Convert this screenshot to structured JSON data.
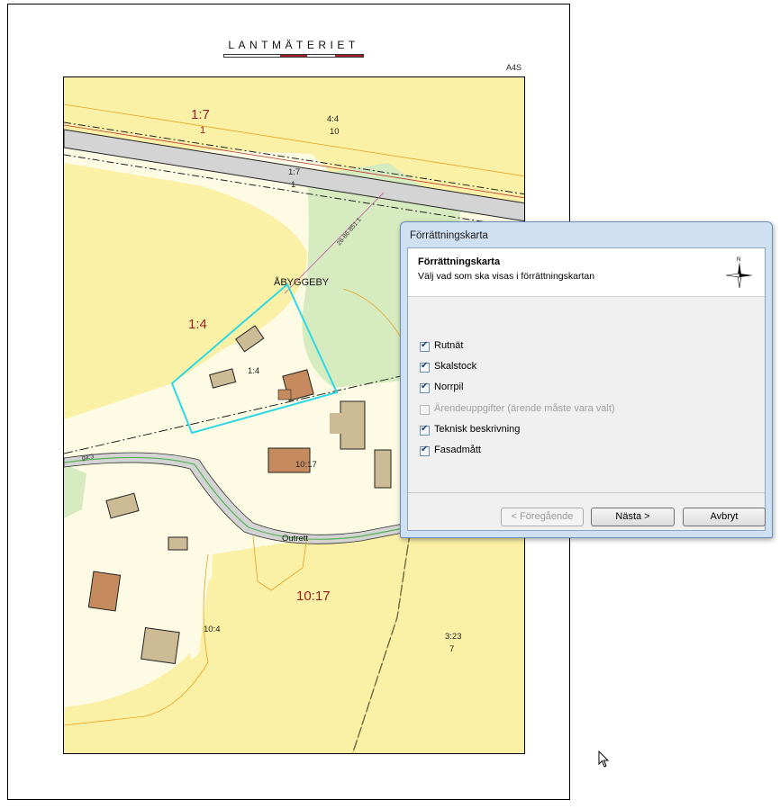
{
  "sheet": {
    "logo_text": "LANTMÄTERIET",
    "format_label": "A4S"
  },
  "map": {
    "labels": {
      "parcel_1_7_big": "1:7",
      "parcel_1_7_big_sub": "1",
      "parcel_4_4": "4:4",
      "parcel_4_4_sub": "10",
      "parcel_1_7_road": "1:7",
      "parcel_1_7_road_sub": "1",
      "boundary_line": "28-86-851.1",
      "village_name": "ÅBYGGEBY",
      "parcel_1_4_big": "1:4",
      "parcel_1_4_small": "1:4",
      "parcel_10_17_small": "10:17",
      "ga_label": "ga:3",
      "road_name": "Outrett",
      "parcel_10_17_big": "10:17",
      "parcel_10_4": "10:4",
      "parcel_3_23": "3:23",
      "parcel_3_23_sub": "7"
    }
  },
  "dialog": {
    "title": "Förrättningskarta",
    "heading": "Förrättningskarta",
    "subheading": "Välj vad som ska visas i förrättningskartan",
    "compass_icon": "north-arrow-icon",
    "options": [
      {
        "label": "Rutnät",
        "checked": true,
        "enabled": true
      },
      {
        "label": "Skalstock",
        "checked": true,
        "enabled": true
      },
      {
        "label": "Norrpil",
        "checked": true,
        "enabled": true
      },
      {
        "label": "Ärendeuppgifter (ärende måste vara valt)",
        "checked": false,
        "enabled": false
      },
      {
        "label": "Teknisk beskrivning",
        "checked": true,
        "enabled": true
      },
      {
        "label": "Fasadmått",
        "checked": true,
        "enabled": true
      }
    ],
    "buttons": {
      "previous": "< Föregående",
      "next": "Nästa >",
      "cancel": "Avbryt"
    }
  },
  "colors": {
    "map_yellow": "#fbf1a6",
    "map_light": "#fdfbe4",
    "map_green": "#d6ecc0",
    "road_gray": "#d4d4d4",
    "building_brown": "#c68a5f",
    "building_tan": "#cdbb96",
    "selection_cyan": "#2fd8e6",
    "parcel_red": "#9b2020",
    "dialog_frame": "#cfe0f3"
  }
}
